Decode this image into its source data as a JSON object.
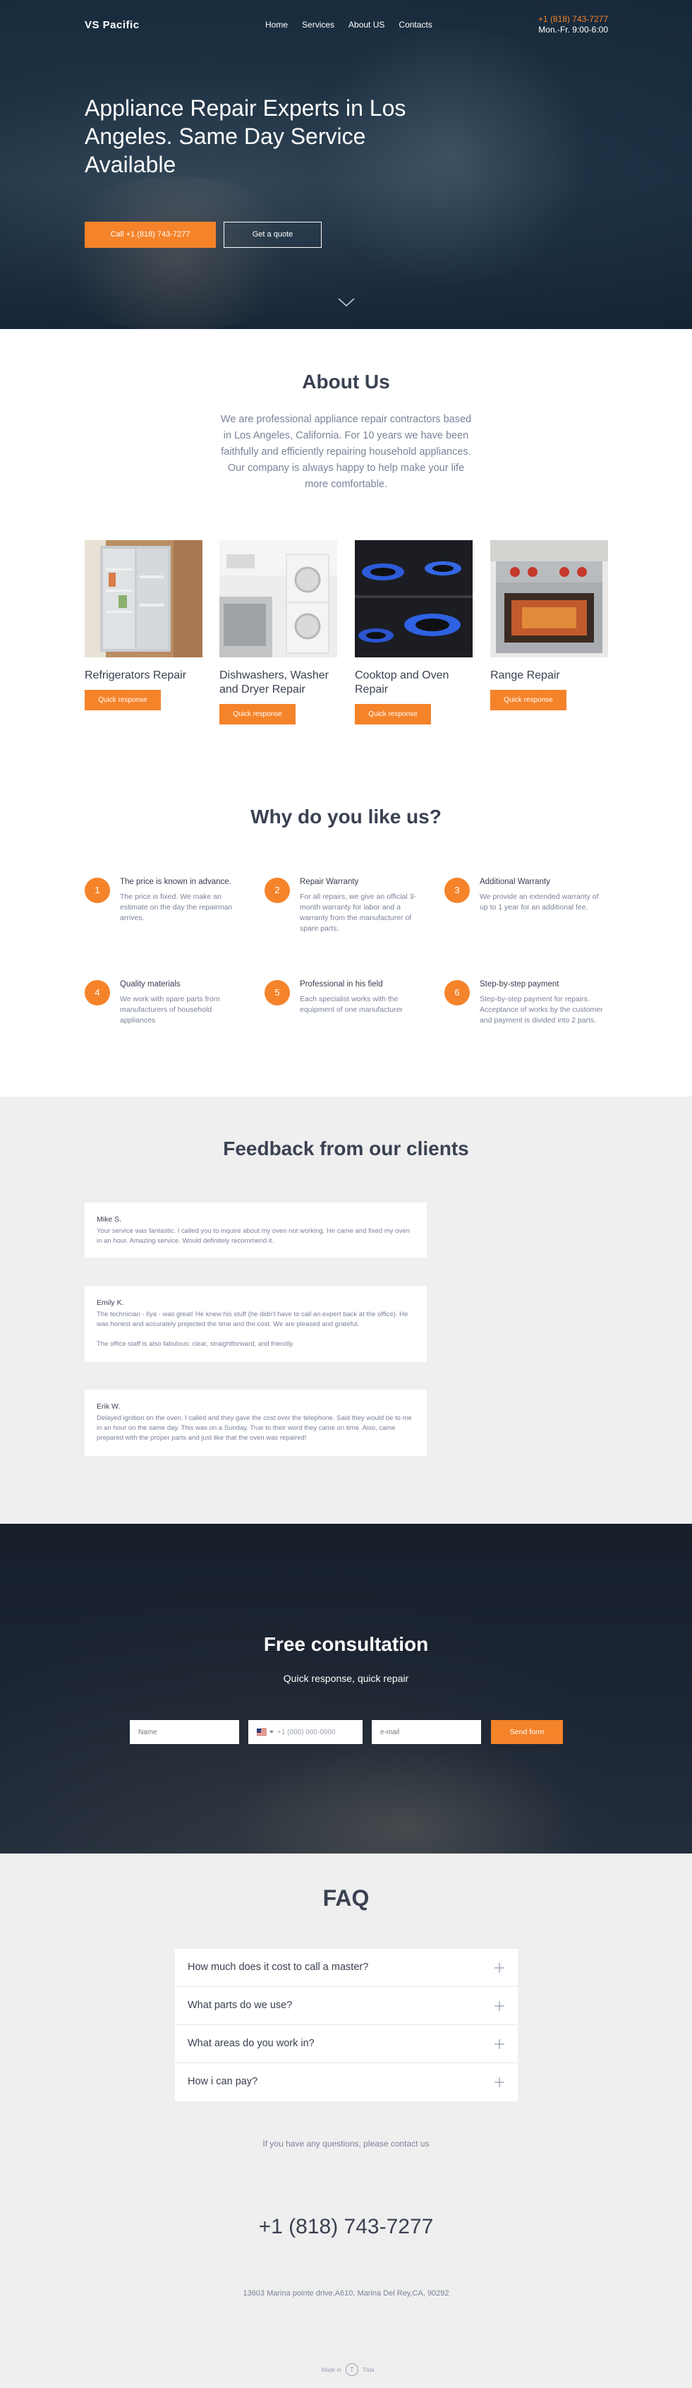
{
  "header": {
    "logo": "VS Pacific",
    "nav": [
      "Home",
      "Services",
      "About US",
      "Contacts"
    ],
    "phone": "+1 (818) 743-7277",
    "hours": "Mon.-Fr. 9:00-6:00"
  },
  "hero": {
    "title": "Appliance Repair Experts in Los Angeles. Same Day Service Available",
    "call_button": "Call +1 (818) 743-7277",
    "quote_button": "Get a quote"
  },
  "about": {
    "title": "About Us",
    "text": "We are professional appliance repair contractors based in Los Angeles, California. For 10 years we have been faithfully and efficiently repairing household appliances. Our company is always happy to help make your life more comfortable."
  },
  "services": [
    {
      "name": "Refrigerators Repair",
      "button": "Quick response"
    },
    {
      "name": "Dishwashers, Washer and Dryer Repair",
      "button": "Quick response"
    },
    {
      "name": "Cooktop and Oven Repair",
      "button": "Quick response"
    },
    {
      "name": "Range Repair",
      "button": "Quick response"
    }
  ],
  "why": {
    "title": "Why do you like us?",
    "features": [
      {
        "num": "1",
        "title": "The price is known in advance.",
        "text": "The price is fixed. We make an estimate on the day the repairman arrives."
      },
      {
        "num": "2",
        "title": "Repair Warranty",
        "text": "For all repairs, we give an official 3-month warranty for labor and a warranty from the manufacturer of spare parts."
      },
      {
        "num": "3",
        "title": "Additional Warranty",
        "text": "We provide an extended warranty of up to 1 year for an additional fee."
      },
      {
        "num": "4",
        "title": "Quality materials",
        "text": "We work with spare parts from manufacturers of household appliances"
      },
      {
        "num": "5",
        "title": "Professional in his field",
        "text": "Each specialist works with the equipment of one manufacturer"
      },
      {
        "num": "6",
        "title": "Step-by-step payment",
        "text": "Step-by-step payment for repairs. Acceptance of works by the customer and payment is divided into 2 parts."
      }
    ]
  },
  "feedback": {
    "title": "Feedback from our clients",
    "reviews": [
      {
        "name": "Mike S.",
        "text": "Your service was fantastic. I called you to inquire about my oven not working. He came and fixed my oven in an hour. Amazing service. Would definitely recommend it.",
        "text2": ""
      },
      {
        "name": "Emily K.",
        "text": "The technician - Ilya - was great! He knew his stuff (he didn't have to call an expert back at the office). He was honest and accurately projected the time and the cost. We are pleased and grateful.",
        "text2": "The office staff is also fabulous: clear, straightforward, and friendly."
      },
      {
        "name": "Erik W.",
        "text": "Delayed ignition on the oven. I called and they gave the cost over the telephone. Said they would be to me in an hour on the same day. This was on a Sunday. True to their word they came on time. Also, came prepared with the proper parts and just like that the oven was repaired!",
        "text2": ""
      }
    ]
  },
  "consultation": {
    "title": "Free consultation",
    "subtitle": "Quick response, quick repair",
    "name_placeholder": "Name",
    "phone_placeholder": "+1 (000) 000-0000",
    "email_placeholder": "e-mail",
    "send_button": "Send form"
  },
  "faq": {
    "title": "FAQ",
    "questions": [
      "How much does it cost to call a master?",
      "What parts do we use?",
      "What areas do you work in?",
      "How i can pay?"
    ],
    "contact_text": "If you have any questions, please contact us",
    "phone": "+1 (818) 743-7277",
    "address": "13603 Marina pointe drive,A610, Marina Del Rey,CA, 90292",
    "made_in": "Made in",
    "made_in_logo": "T",
    "made_in_brand": "Tilda"
  },
  "colors": {
    "accent": "#f5832a",
    "heading": "#3a4151",
    "muted": "#7a8398",
    "section_gray": "#efefef"
  }
}
